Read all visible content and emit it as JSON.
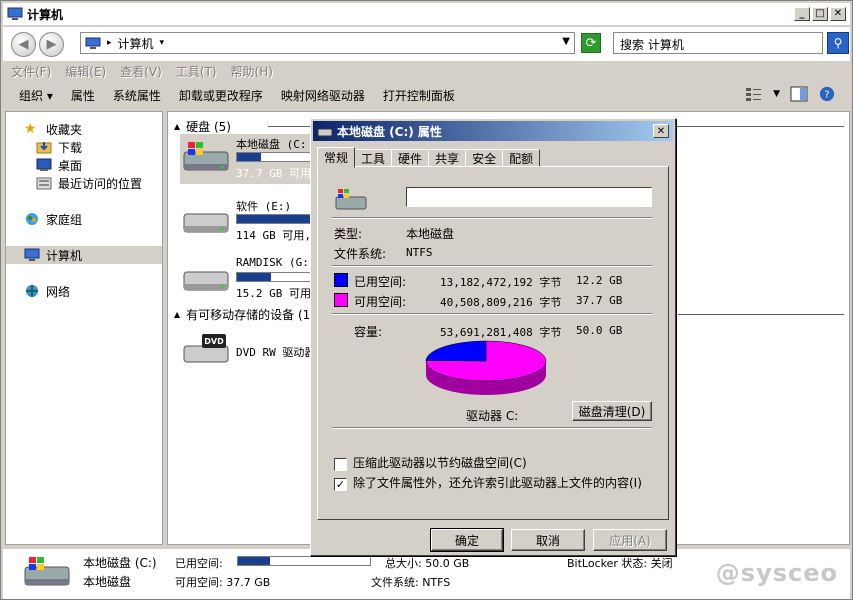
{
  "window": {
    "title": "计算机"
  },
  "address": {
    "crumb": "计算机",
    "sep": "▸",
    "search_placeholder": "搜索 计算机"
  },
  "menubar": [
    "文件(F)",
    "编辑(E)",
    "查看(V)",
    "工具(T)",
    "帮助(H)"
  ],
  "toolbar": [
    "组织 ▾",
    "属性",
    "系统属性",
    "卸载或更改程序",
    "映射网络驱动器",
    "打开控制面板"
  ],
  "nav": {
    "favorites": "收藏夹",
    "downloads": "下载",
    "desktop": "桌面",
    "recent": "最近访问的位置",
    "homegroup": "家庭组",
    "computer": "计算机",
    "network": "网络"
  },
  "content": {
    "hdd_group": "硬盘 (5)",
    "removable_group": "有可移动存储的设备 (1",
    "drives": [
      {
        "name": "本地磁盘 (C:",
        "info": "37.7 GB 可用",
        "fill": 0.24
      },
      {
        "name": "软件 (E:)",
        "info": "114 GB 可用,",
        "fill": 0.9
      },
      {
        "name": "RAMDISK (G:)",
        "info": "15.2 GB 可用",
        "fill": 0.35
      }
    ],
    "dvd": {
      "name": "DVD RW 驱动器",
      "label": "DVD"
    }
  },
  "details": {
    "name1": "本地磁盘 (C:)",
    "name2": "本地磁盘",
    "used_label": "已用空间:",
    "free_label": "可用空间: 37.7 GB",
    "total": "总大小: 50.0 GB",
    "fs": "文件系统: NTFS",
    "bitlocker": "BitLocker 状态: 关闭",
    "watermark": "@sysceo"
  },
  "dialog": {
    "title": "本地磁盘 (C:) 属性",
    "tabs": [
      "常规",
      "工具",
      "硬件",
      "共享",
      "安全",
      "配额"
    ],
    "name_value": "",
    "type_label": "类型:",
    "type_value": "本地磁盘",
    "fs_label": "文件系统:",
    "fs_value": "NTFS",
    "used_label": "已用空间:",
    "used_bytes": "13,182,472,192 字节",
    "used_gb": "12.2 GB",
    "free_label": "可用空间:",
    "free_bytes": "40,508,809,216 字节",
    "free_gb": "37.7 GB",
    "cap_label": "容量:",
    "cap_bytes": "53,691,281,408 字节",
    "cap_gb": "50.0 GB",
    "drive_label": "驱动器 C:",
    "cleanup_button": "磁盘清理(D)",
    "compress_label": "压缩此驱动器以节约磁盘空间(C)",
    "compress_checked": false,
    "index_label": "除了文件属性外，还允许索引此驱动器上文件的内容(I)",
    "index_checked": true,
    "ok": "确定",
    "cancel": "取消",
    "apply": "应用(A)",
    "used_color": "#0000ff",
    "free_color": "#ff00ff",
    "used_fraction": 0.2455
  }
}
